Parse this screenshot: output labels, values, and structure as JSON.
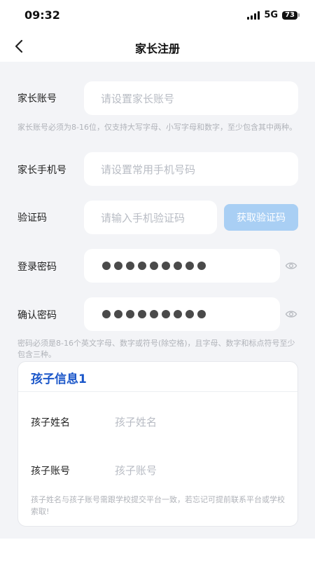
{
  "status": {
    "time": "09:32",
    "network": "5G",
    "battery": "73"
  },
  "nav": {
    "title": "家长注册"
  },
  "form": {
    "account": {
      "label": "家长账号",
      "placeholder": "请设置家长账号",
      "hint": "家长账号必须为8-16位，仅支持大写字母、小写字母和数字，至少包含其中两种。"
    },
    "phone": {
      "label": "家长手机号",
      "placeholder": "请设置常用手机号码"
    },
    "code": {
      "label": "验证码",
      "placeholder": "请输入手机验证码",
      "button": "获取验证码"
    },
    "password": {
      "label": "登录密码",
      "masked_length": 9
    },
    "confirm": {
      "label": "确认密码",
      "masked_length": 9,
      "hint": "密码必须是8-16个英文字母、数字或符号(除空格)，且字母、数字和标点符号至少包含三种。"
    }
  },
  "child": {
    "title": "孩子信息1",
    "name": {
      "label": "孩子姓名",
      "placeholder": "孩子姓名"
    },
    "account": {
      "label": "孩子账号",
      "placeholder": "孩子账号"
    },
    "hint": "孩子姓名与孩子账号需跟学校提交平台一致，若忘记可提前联系平台或学校索取!"
  },
  "icons": {
    "back": "chevron-left-icon",
    "eye": "eye-icon",
    "signal": "signal-icon",
    "battery": "battery-icon"
  },
  "colors": {
    "accent": "#1a56c9",
    "button_disabled": "#a9cff4",
    "background": "#f3f4f7"
  }
}
